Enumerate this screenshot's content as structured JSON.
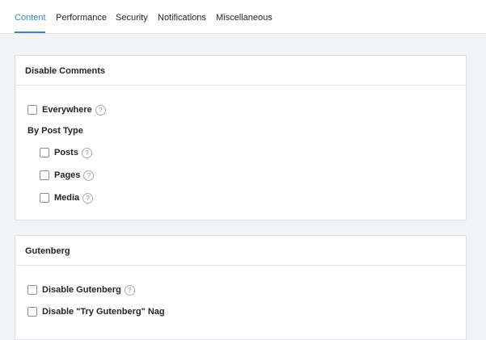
{
  "tabs": [
    {
      "label": "Content",
      "active": true
    },
    {
      "label": "Performance",
      "active": false
    },
    {
      "label": "Security",
      "active": false
    },
    {
      "label": "Notifications",
      "active": false
    },
    {
      "label": "Miscellaneous",
      "active": false
    }
  ],
  "colors": {
    "accent": "#3b82c4",
    "background": "#f2f3f5",
    "card": "#ffffff"
  },
  "disable_comments": {
    "title": "Disable Comments",
    "everywhere": {
      "label": "Everywhere",
      "checked": false
    },
    "by_post_type_heading": "By Post Type",
    "post_types": [
      {
        "label": "Posts",
        "checked": false
      },
      {
        "label": "Pages",
        "checked": false
      },
      {
        "label": "Media",
        "checked": false
      }
    ]
  },
  "gutenberg": {
    "title": "Gutenberg",
    "options": [
      {
        "label": "Disable Gutenberg",
        "checked": false,
        "has_help": true
      },
      {
        "label": "Disable \"Try Gutenberg\" Nag",
        "checked": false,
        "has_help": false
      }
    ]
  },
  "help_icon_glyph": "?"
}
